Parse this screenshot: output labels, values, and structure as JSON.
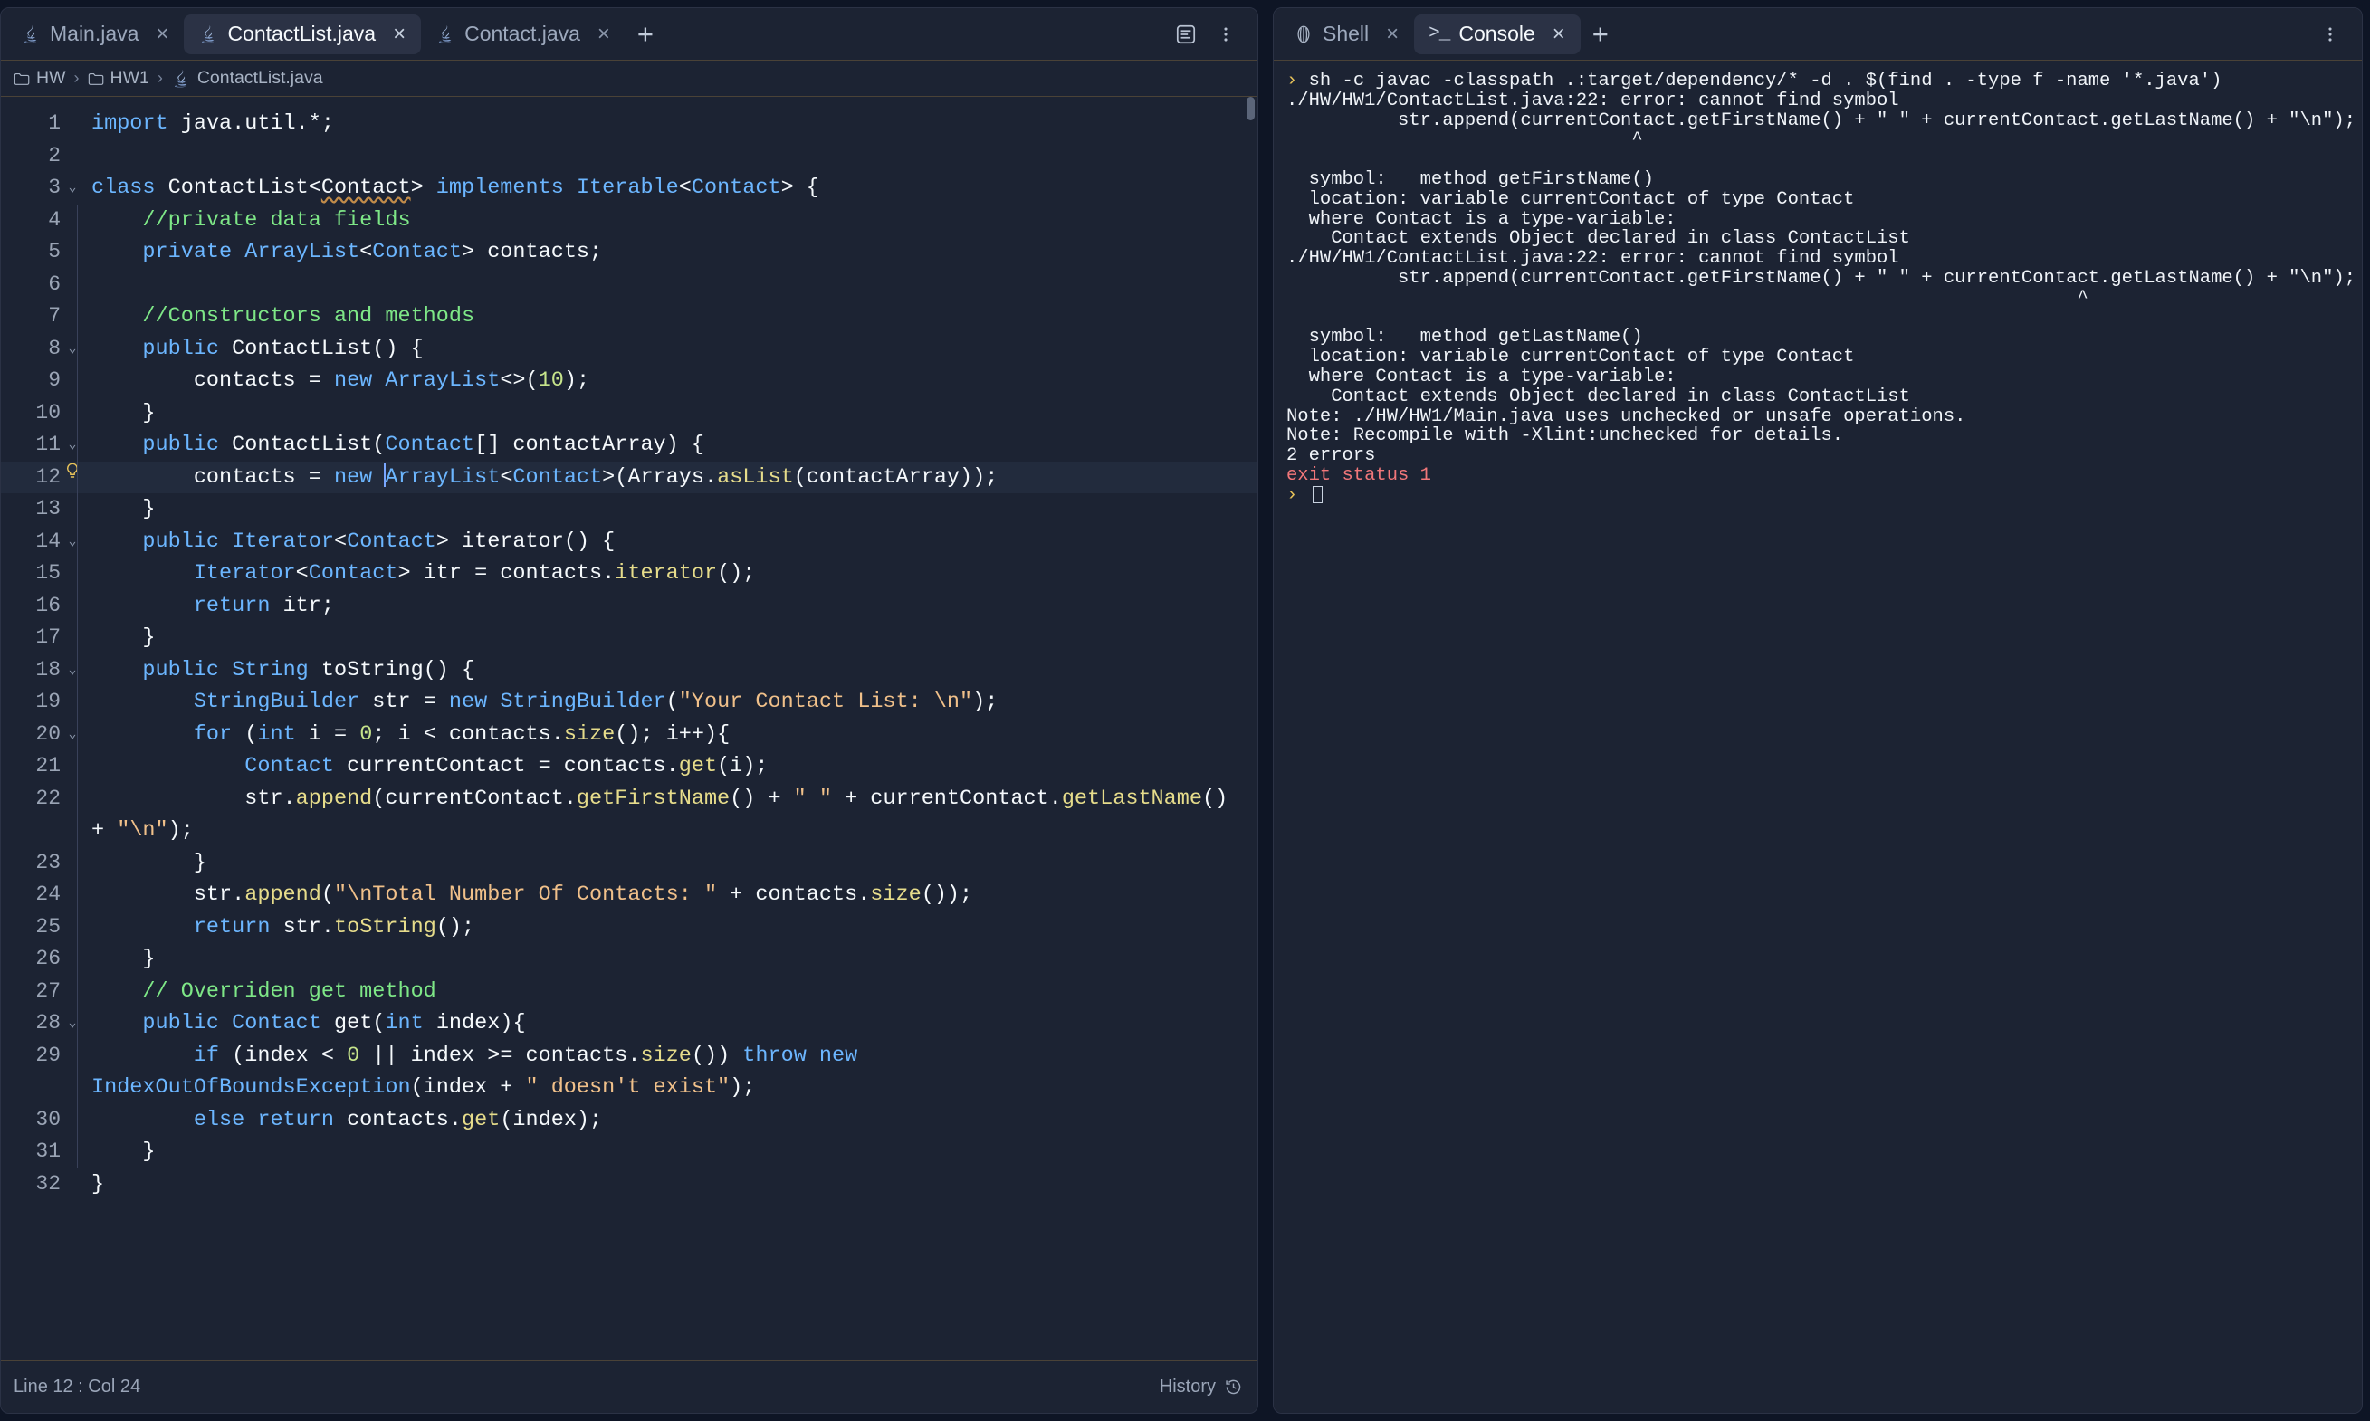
{
  "editor_pane": {
    "tabs": [
      {
        "label": "Main.java",
        "icon": "java-icon",
        "active": false,
        "close": "×"
      },
      {
        "label": "ContactList.java",
        "icon": "java-icon",
        "active": true,
        "close": "×"
      },
      {
        "label": "Contact.java",
        "icon": "java-icon",
        "active": false,
        "close": "×"
      }
    ],
    "add_tab_label": "+",
    "toolbar": {
      "format_icon": "document-format-icon",
      "overflow_icon": "more-options-icon"
    },
    "breadcrumb": {
      "items": [
        "HW",
        "HW1"
      ],
      "separator": "›",
      "file": "ContactList.java"
    },
    "statusbar": {
      "position": "Line 12 : Col 24",
      "history_label": "History"
    }
  },
  "console_pane": {
    "tabs": [
      {
        "label": "Shell",
        "icon": "shell-icon",
        "active": false,
        "close": "×"
      },
      {
        "label": "Console",
        "icon": "console-prompt-icon",
        "active": true,
        "close": "×"
      }
    ],
    "add_tab_label": "+",
    "overflow_icon": "more-options-icon",
    "output": [
      {
        "type": "prompt",
        "prompt": "› ",
        "text": "sh -c javac -classpath .:target/dependency/* -d . $(find . -type f -name '*.java')"
      },
      {
        "type": "plain",
        "text": "./HW/HW1/ContactList.java:22: error: cannot find symbol"
      },
      {
        "type": "plain",
        "text": "          str.append(currentContact.getFirstName() + \" \" + currentContact.getLastName() + \"\\n\");"
      },
      {
        "type": "plain",
        "text": "                               ^"
      },
      {
        "type": "plain",
        "text": ""
      },
      {
        "type": "plain",
        "text": "  symbol:   method getFirstName()"
      },
      {
        "type": "plain",
        "text": "  location: variable currentContact of type Contact"
      },
      {
        "type": "plain",
        "text": "  where Contact is a type-variable:"
      },
      {
        "type": "plain",
        "text": "    Contact extends Object declared in class ContactList"
      },
      {
        "type": "plain",
        "text": "./HW/HW1/ContactList.java:22: error: cannot find symbol"
      },
      {
        "type": "plain",
        "text": "          str.append(currentContact.getFirstName() + \" \" + currentContact.getLastName() + \"\\n\");"
      },
      {
        "type": "plain",
        "text": "                                                                       ^"
      },
      {
        "type": "plain",
        "text": ""
      },
      {
        "type": "plain",
        "text": "  symbol:   method getLastName()"
      },
      {
        "type": "plain",
        "text": "  location: variable currentContact of type Contact"
      },
      {
        "type": "plain",
        "text": "  where Contact is a type-variable:"
      },
      {
        "type": "plain",
        "text": "    Contact extends Object declared in class ContactList"
      },
      {
        "type": "plain",
        "text": "Note: ./HW/HW1/Main.java uses unchecked or unsafe operations."
      },
      {
        "type": "plain",
        "text": "Note: Recompile with -Xlint:unchecked for details."
      },
      {
        "type": "plain",
        "text": "2 errors"
      },
      {
        "type": "error",
        "text": "exit status 1"
      },
      {
        "type": "cursor",
        "prompt": "› "
      }
    ]
  },
  "code": {
    "language": "java",
    "filename": "ContactList.java",
    "cursor_line": 12,
    "lines": [
      {
        "n": 1,
        "fold": false,
        "bulb": false,
        "indent": false,
        "html": "<span class=\"kw\">import</span> <span class=\"pln\">java.util.*;</span>"
      },
      {
        "n": 2,
        "fold": false,
        "bulb": false,
        "indent": false,
        "html": ""
      },
      {
        "n": 3,
        "fold": true,
        "bulb": false,
        "indent": false,
        "html": "<span class=\"kw\">class</span> <span class=\"pln\">ContactList&lt;</span><span class=\"pln err-underline\">Contact</span><span class=\"pln\">&gt; </span><span class=\"kw\">implements</span> <span class=\"type\">Iterable</span><span class=\"pln\">&lt;</span><span class=\"type\">Contact</span><span class=\"pln\">&gt; {</span>"
      },
      {
        "n": 4,
        "fold": false,
        "bulb": false,
        "indent": true,
        "html": "    <span class=\"cmt\">//private data fields</span>"
      },
      {
        "n": 5,
        "fold": false,
        "bulb": false,
        "indent": true,
        "html": "    <span class=\"kw\">private</span> <span class=\"type\">ArrayList</span><span class=\"pln\">&lt;</span><span class=\"type\">Contact</span><span class=\"pln\">&gt; contacts;</span>"
      },
      {
        "n": 6,
        "fold": false,
        "bulb": false,
        "indent": true,
        "html": ""
      },
      {
        "n": 7,
        "fold": false,
        "bulb": false,
        "indent": true,
        "html": "    <span class=\"cmt\">//Constructors and methods</span>"
      },
      {
        "n": 8,
        "fold": true,
        "bulb": false,
        "indent": true,
        "html": "    <span class=\"kw\">public</span> <span class=\"pln\">ContactList() {</span>"
      },
      {
        "n": 9,
        "fold": false,
        "bulb": false,
        "indent": true,
        "html": "        <span class=\"pln\">contacts = </span><span class=\"kw\">new</span> <span class=\"type\">ArrayList</span><span class=\"pln\">&lt;&gt;(</span><span class=\"num\">10</span><span class=\"pln\">);</span>"
      },
      {
        "n": 10,
        "fold": false,
        "bulb": false,
        "indent": true,
        "html": "    <span class=\"pln\">}</span>"
      },
      {
        "n": 11,
        "fold": true,
        "bulb": false,
        "indent": true,
        "html": "    <span class=\"kw\">public</span> <span class=\"pln\">ContactList(</span><span class=\"type\">Contact</span><span class=\"pln\">[] contactArray) {</span>"
      },
      {
        "n": 12,
        "fold": false,
        "bulb": true,
        "indent": true,
        "highlight": true,
        "html": "        <span class=\"pln\">contacts = </span><span class=\"kw\">new</span> <span class=\"pln\">&#8203;</span><span class=\"caret\"></span><span class=\"type\">ArrayList</span><span class=\"pln\">&lt;</span><span class=\"type\">Contact</span><span class=\"pln\">&gt;(Arrays.</span><span class=\"fn\">asList</span><span class=\"pln\">(contactArray));</span>"
      },
      {
        "n": 13,
        "fold": false,
        "bulb": false,
        "indent": true,
        "html": "    <span class=\"pln\">}</span>"
      },
      {
        "n": 14,
        "fold": true,
        "bulb": false,
        "indent": true,
        "html": "    <span class=\"kw\">public</span> <span class=\"type\">Iterator</span><span class=\"pln\">&lt;</span><span class=\"type\">Contact</span><span class=\"pln\">&gt; iterator() {</span>"
      },
      {
        "n": 15,
        "fold": false,
        "bulb": false,
        "indent": true,
        "html": "        <span class=\"type\">Iterator</span><span class=\"pln\">&lt;</span><span class=\"type\">Contact</span><span class=\"pln\">&gt; itr = contacts.</span><span class=\"fn\">iterator</span><span class=\"pln\">();</span>"
      },
      {
        "n": 16,
        "fold": false,
        "bulb": false,
        "indent": true,
        "html": "        <span class=\"kw\">return</span> <span class=\"pln\">itr;</span>"
      },
      {
        "n": 17,
        "fold": false,
        "bulb": false,
        "indent": true,
        "html": "    <span class=\"pln\">}</span>"
      },
      {
        "n": 18,
        "fold": true,
        "bulb": false,
        "indent": true,
        "html": "    <span class=\"kw\">public</span> <span class=\"type\">String</span> <span class=\"pln\">toString() {</span>"
      },
      {
        "n": 19,
        "fold": false,
        "bulb": false,
        "indent": true,
        "html": "        <span class=\"type\">StringBuilder</span> <span class=\"pln\">str = </span><span class=\"kw\">new</span> <span class=\"type\">StringBuilder</span><span class=\"pln\">(</span><span class=\"str\">\"Your Contact List: \\n\"</span><span class=\"pln\">);</span>"
      },
      {
        "n": 20,
        "fold": true,
        "bulb": false,
        "indent": true,
        "html": "        <span class=\"kw\">for</span> <span class=\"pln\">(</span><span class=\"kw\">int</span> <span class=\"pln\">i = </span><span class=\"num\">0</span><span class=\"pln\">; i &lt; contacts.</span><span class=\"fn\">size</span><span class=\"pln\">(); i++){</span>"
      },
      {
        "n": 21,
        "fold": false,
        "bulb": false,
        "indent": true,
        "html": "            <span class=\"type\">Contact</span> <span class=\"pln\">currentContact = contacts.</span><span class=\"fn\">get</span><span class=\"pln\">(i);</span>"
      },
      {
        "n": 22,
        "fold": false,
        "bulb": false,
        "indent": true,
        "html": "            <span class=\"pln\">str.</span><span class=\"fn\">append</span><span class=\"pln\">(currentContact.</span><span class=\"fn\">getFirstName</span><span class=\"pln\">() + </span><span class=\"str\">\" \"</span><span class=\"pln\"> + currentContact.</span><span class=\"fn\">getLastName</span><span class=\"pln\">() + </span><span class=\"str\">\"\\n\"</span><span class=\"pln\">);</span>"
      },
      {
        "n": 23,
        "fold": false,
        "bulb": false,
        "indent": true,
        "html": "        <span class=\"pln\">}</span>"
      },
      {
        "n": 24,
        "fold": false,
        "bulb": false,
        "indent": true,
        "html": "        <span class=\"pln\">str.</span><span class=\"fn\">append</span><span class=\"pln\">(</span><span class=\"str\">\"\\nTotal Number Of Contacts: \"</span><span class=\"pln\"> + contacts.</span><span class=\"fn\">size</span><span class=\"pln\">());</span>"
      },
      {
        "n": 25,
        "fold": false,
        "bulb": false,
        "indent": true,
        "html": "        <span class=\"kw\">return</span> <span class=\"pln\">str.</span><span class=\"fn\">toString</span><span class=\"pln\">();</span>"
      },
      {
        "n": 26,
        "fold": false,
        "bulb": false,
        "indent": true,
        "html": "    <span class=\"pln\">}</span>"
      },
      {
        "n": 27,
        "fold": false,
        "bulb": false,
        "indent": true,
        "html": "    <span class=\"cmt\">// Overriden get method</span>"
      },
      {
        "n": 28,
        "fold": true,
        "bulb": false,
        "indent": true,
        "html": "    <span class=\"kw\">public</span> <span class=\"type\">Contact</span> <span class=\"pln\">get(</span><span class=\"kw\">int</span> <span class=\"pln\">index){</span>"
      },
      {
        "n": 29,
        "fold": false,
        "bulb": false,
        "indent": true,
        "html": "        <span class=\"kw\">if</span> <span class=\"pln\">(index &lt; </span><span class=\"num\">0</span><span class=\"pln\"> || index &gt;= contacts.</span><span class=\"fn\">size</span><span class=\"pln\">()) </span><span class=\"kw\">throw new</span> <span class=\"type\">IndexOutOfBoundsException</span><span class=\"pln\">(index + </span><span class=\"str\">\" doesn't exist\"</span><span class=\"pln\">);</span>"
      },
      {
        "n": 30,
        "fold": false,
        "bulb": false,
        "indent": true,
        "html": "        <span class=\"kw\">else return</span> <span class=\"pln\">contacts.</span><span class=\"fn\">get</span><span class=\"pln\">(index);</span>"
      },
      {
        "n": 31,
        "fold": false,
        "bulb": false,
        "indent": true,
        "html": "    <span class=\"pln\">}</span>"
      },
      {
        "n": 32,
        "fold": false,
        "bulb": false,
        "indent": false,
        "html": "<span class=\"pln\">}</span>"
      }
    ]
  }
}
